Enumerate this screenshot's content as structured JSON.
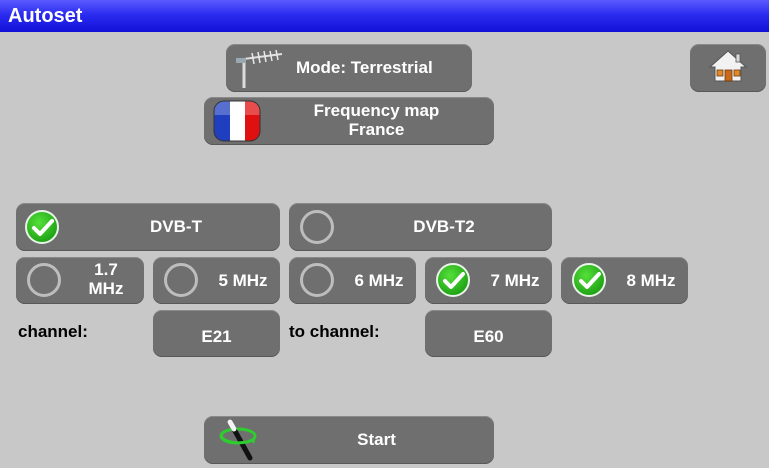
{
  "window": {
    "title": "Autoset"
  },
  "mode_button": {
    "label": "Mode: Terrestrial"
  },
  "frequency_map": {
    "line1": "Frequency map",
    "line2": "France"
  },
  "standards": [
    {
      "label": "DVB-T",
      "checked": true
    },
    {
      "label": "DVB-T2",
      "checked": false
    }
  ],
  "bandwidths": [
    {
      "line1": "1.7",
      "line2": "MHz",
      "checked": false
    },
    {
      "label": "5 MHz",
      "checked": false
    },
    {
      "label": "6 MHz",
      "checked": false
    },
    {
      "label": "7 MHz",
      "checked": true
    },
    {
      "label": "8 MHz",
      "checked": true
    }
  ],
  "channel_range": {
    "from_label": "channel:",
    "from_value": "E21",
    "to_label": "to channel:",
    "to_value": "E60"
  },
  "start_button": {
    "label": "Start"
  },
  "icons": {
    "home": "home-icon",
    "antenna": "antenna-icon",
    "flag": "france-flag-icon",
    "start": "magic-wand-icon",
    "check": "check-icon"
  },
  "colors": {
    "title_bar": "#1a1ae0",
    "button": "#6f6f6f",
    "background": "#c8c8c8",
    "check_on": "#2fbf1f"
  }
}
